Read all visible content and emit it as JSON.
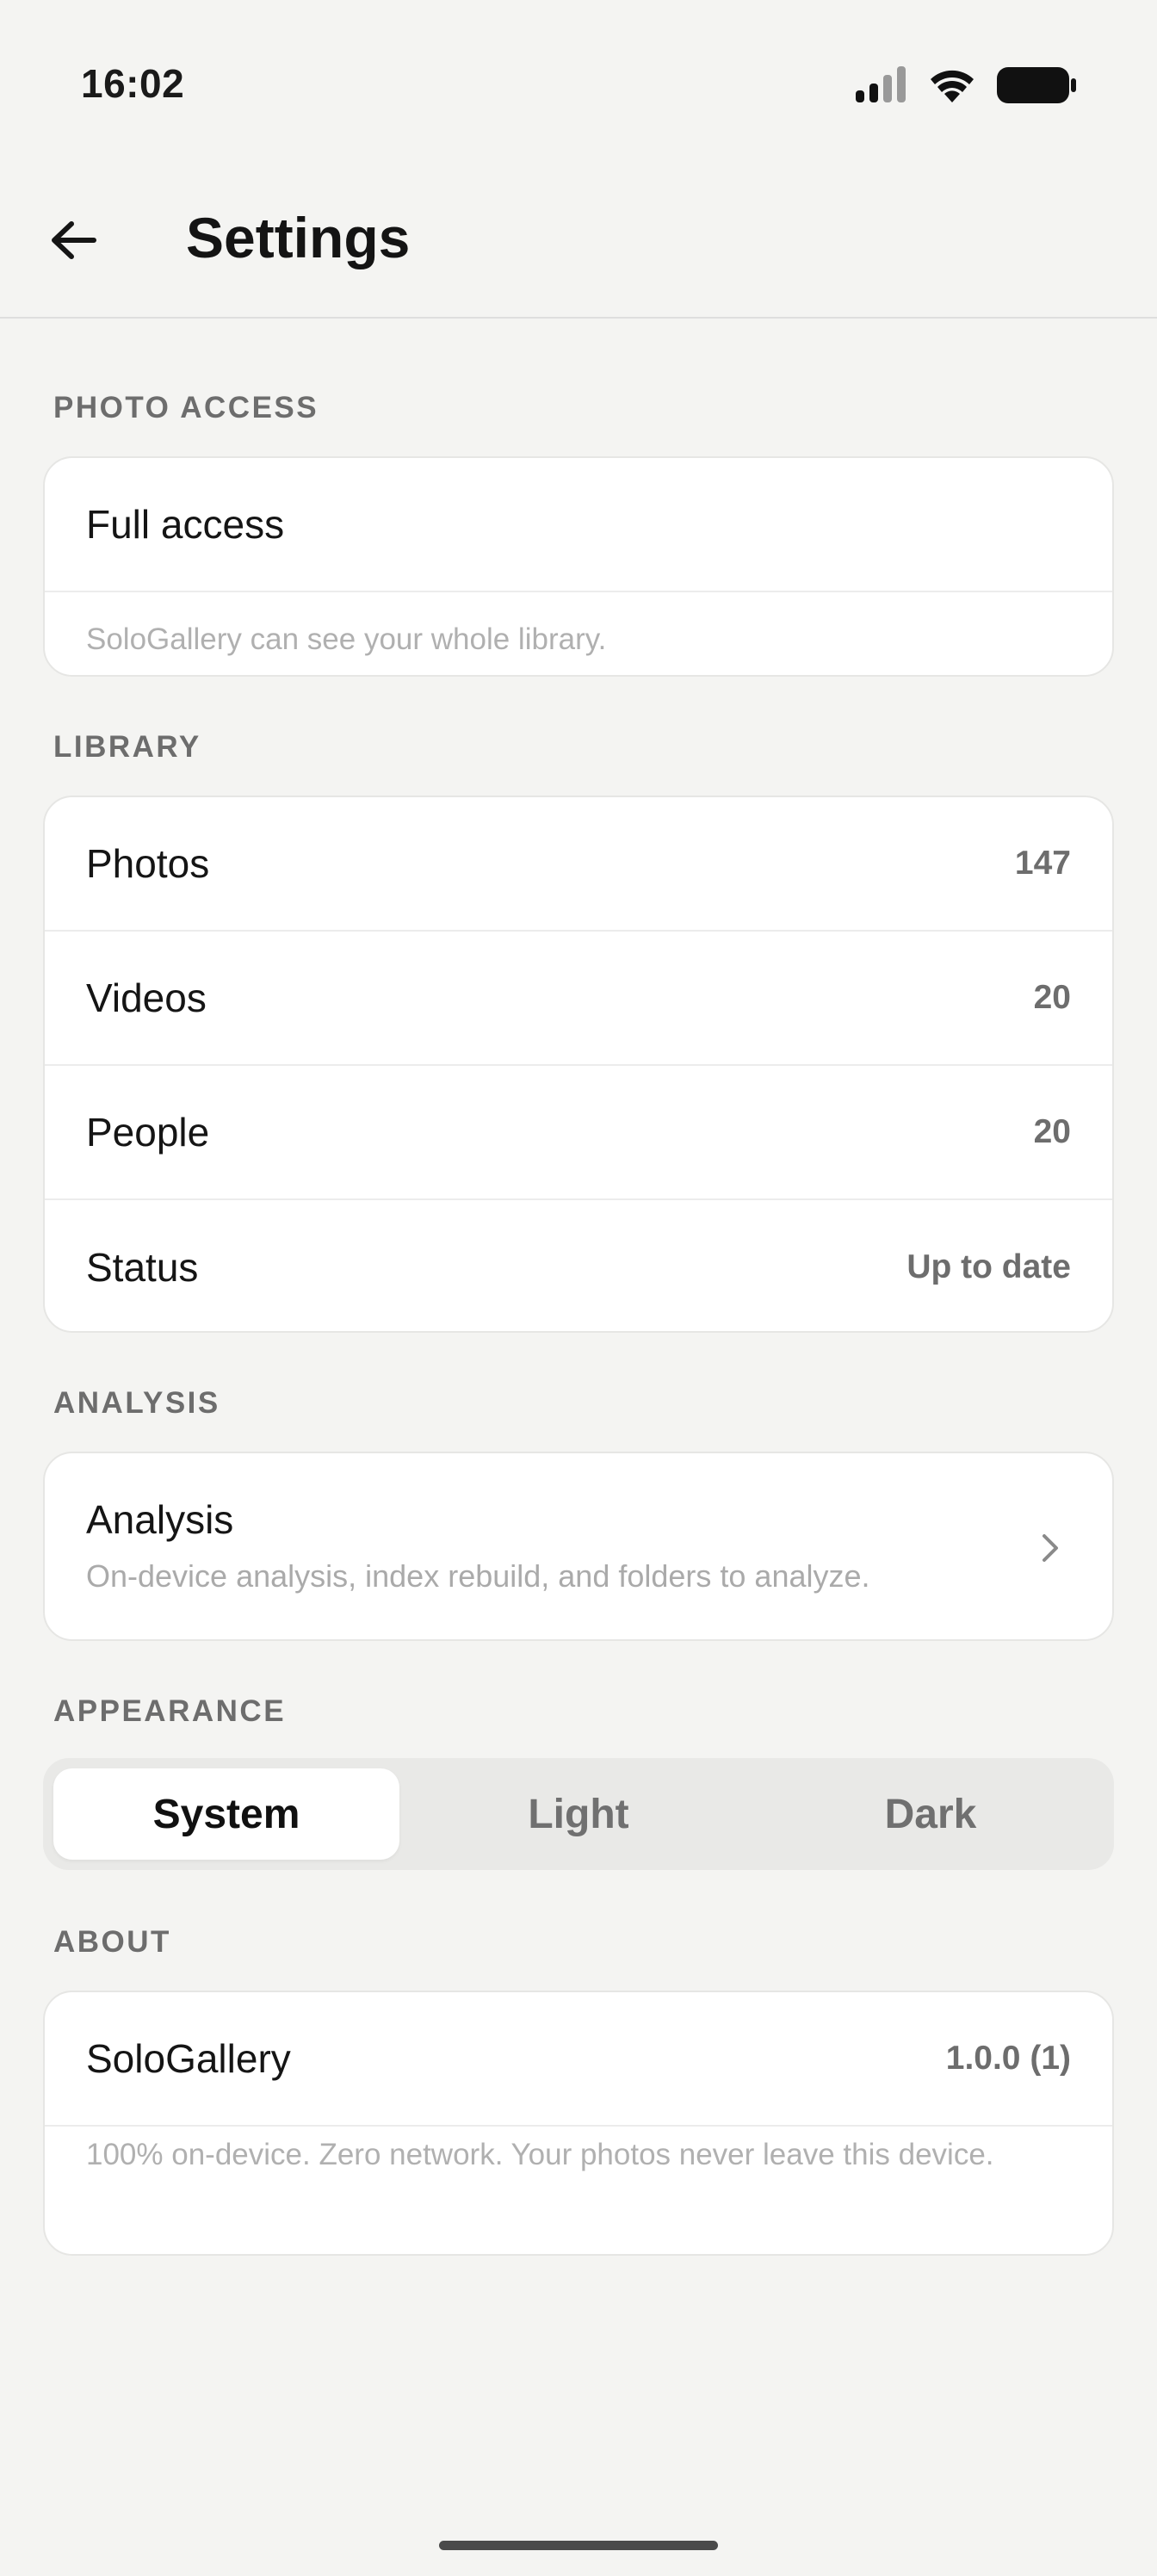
{
  "status_bar": {
    "time": "16:02"
  },
  "header": {
    "title": "Settings"
  },
  "photo_access": {
    "section_label": "PHOTO ACCESS",
    "status": "Full access",
    "description": "SoloGallery can see your whole library."
  },
  "library": {
    "section_label": "LIBRARY",
    "rows": [
      {
        "label": "Photos",
        "value": "147"
      },
      {
        "label": "Videos",
        "value": "20"
      },
      {
        "label": "People",
        "value": "20"
      },
      {
        "label": "Status",
        "value": "Up to date"
      }
    ]
  },
  "analysis": {
    "section_label": "ANALYSIS",
    "title": "Analysis",
    "subtitle": "On-device analysis, index rebuild, and folders to analyze."
  },
  "appearance": {
    "section_label": "APPEARANCE",
    "options": [
      "System",
      "Light",
      "Dark"
    ],
    "selected": "System"
  },
  "about": {
    "section_label": "ABOUT",
    "app_name": "SoloGallery",
    "version": "1.0.0 (1)",
    "description": "100% on-device. Zero network. Your photos never leave this device."
  }
}
